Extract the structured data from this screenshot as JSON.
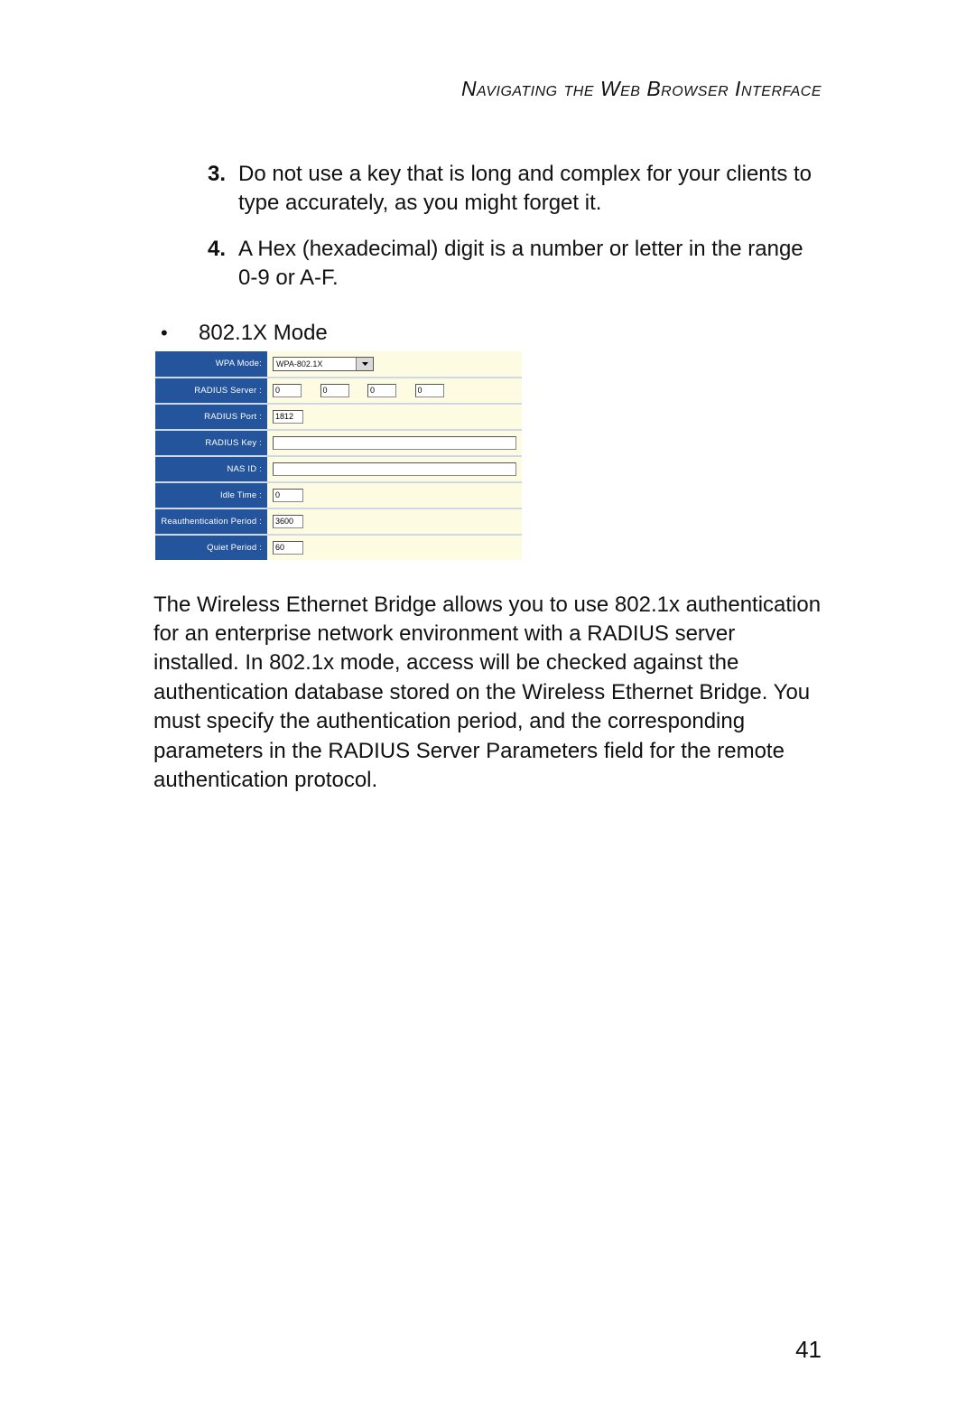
{
  "header": {
    "running_title": "Navigating the Web Browser Interface"
  },
  "olist": {
    "items": [
      {
        "num": "3.",
        "text": "Do not use a key that is long and complex for your clients to type accurately, as you might forget it."
      },
      {
        "num": "4.",
        "text": "A Hex (hexadecimal) digit is a number or letter in the range 0-9 or A-F."
      }
    ]
  },
  "bullet": {
    "marker": "•",
    "text": "802.1X Mode"
  },
  "form": {
    "wpa_mode": {
      "label": "WPA Mode:",
      "value": "WPA-802.1X"
    },
    "radius_server": {
      "label": "RADIUS Server :",
      "oct1": "0",
      "oct2": "0",
      "oct3": "0",
      "oct4": "0"
    },
    "radius_port": {
      "label": "RADIUS Port :",
      "value": "1812"
    },
    "radius_key": {
      "label": "RADIUS Key :",
      "value": ""
    },
    "nas_id": {
      "label": "NAS ID :",
      "value": ""
    },
    "idle_time": {
      "label": "Idle Time :",
      "value": "0"
    },
    "reauth_period": {
      "label": "Reauthentication Period :",
      "value": "3600"
    },
    "quiet_period": {
      "label": "Quiet Period :",
      "value": "60"
    }
  },
  "paragraph": "The Wireless Ethernet Bridge allows you to use 802.1x authentication for an enterprise network environment with a RADIUS server installed. In 802.1x mode, access will be checked against the authentication database stored on the Wireless Ethernet Bridge. You must specify the authentication period, and the corresponding parameters in the RADIUS Server Parameters field for the remote authentication protocol.",
  "page_number": "41"
}
